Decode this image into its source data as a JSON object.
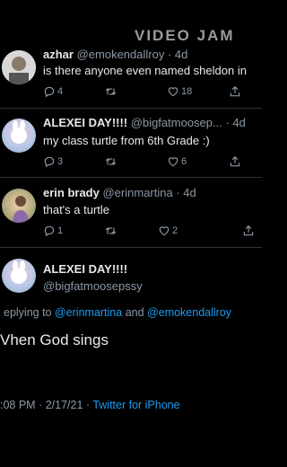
{
  "watermark": "VIDEO JAM",
  "tweets": [
    {
      "name": "azhar",
      "handle": "@emokendallroy",
      "time": "· 4d",
      "text": "is there anyone even named sheldon in",
      "replies": "4",
      "retweets": "",
      "likes": "18"
    },
    {
      "name": "ALEXEI DAY!!!!",
      "handle": "@bigfatmoosep...",
      "time": "· 4d",
      "text": "my class turtle from 6th Grade :)",
      "replies": "3",
      "retweets": "",
      "likes": "6"
    },
    {
      "name": "erin brady",
      "handle": "@erinmartina",
      "time": "· 4d",
      "text": "that's a turtle",
      "replies": "1",
      "retweets": "",
      "likes": "2"
    }
  ],
  "main_tweet": {
    "name": "ALEXEI DAY!!!!",
    "handle": "@bigfatmoosepssy",
    "replying_prefix": "eplying to",
    "mention1": "@erinmartina",
    "and": "and",
    "mention2": "@emokendallroy",
    "text": "Vhen God sings",
    "timestamp": ":08 PM · 2/17/21 ·",
    "app": "Twitter for iPhone"
  },
  "colors": {
    "background": "#000000",
    "text": "#e7e9ea",
    "muted": "#8b98a5",
    "link": "#1d9bf0"
  },
  "icons": [
    "reply-icon",
    "retweet-icon",
    "like-icon",
    "share-icon"
  ]
}
